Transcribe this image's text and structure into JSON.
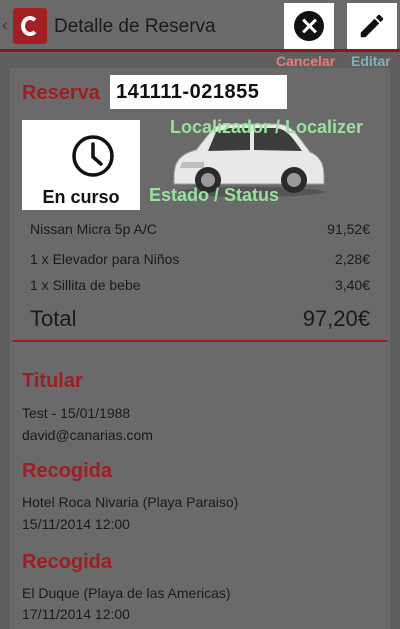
{
  "header": {
    "back_glyph": "‹",
    "title": "Detalle de Reserva"
  },
  "actions": {
    "cancel_label": "Cancelar",
    "edit_label": "Editar"
  },
  "reservation": {
    "label": "Reserva",
    "code": "141111-021855",
    "locator_label": "Localizador / Localizer",
    "status_label": "Estado / Status",
    "status": "En curso"
  },
  "items": [
    {
      "name": "Nissan Micra 5p A/C",
      "price": "91,52€"
    },
    {
      "name": "1 x Elevador para Niños",
      "price": "2,28€"
    },
    {
      "name": "1 x Sillita de bebe",
      "price": "3,40€"
    }
  ],
  "total": {
    "label": "Total",
    "value": "97,20€"
  },
  "holder": {
    "title": "Titular",
    "line1": "Test - 15/01/1988",
    "line2": "david@canarias.com"
  },
  "pickup": {
    "title": "Recogida",
    "line1": "Hotel Roca Nivaria (Playa Paraiso)",
    "line2": "15/11/2014 12:00"
  },
  "dropoff": {
    "title": "Recogida",
    "line1": "El Duque (Playa de las Americas)",
    "line2": "17/11/2014 12:00"
  },
  "colors": {
    "brand": "#a01e20",
    "annotation_green": "#99e29d",
    "annotation_red": "#e77e79",
    "annotation_blue": "#7fb2bf"
  }
}
